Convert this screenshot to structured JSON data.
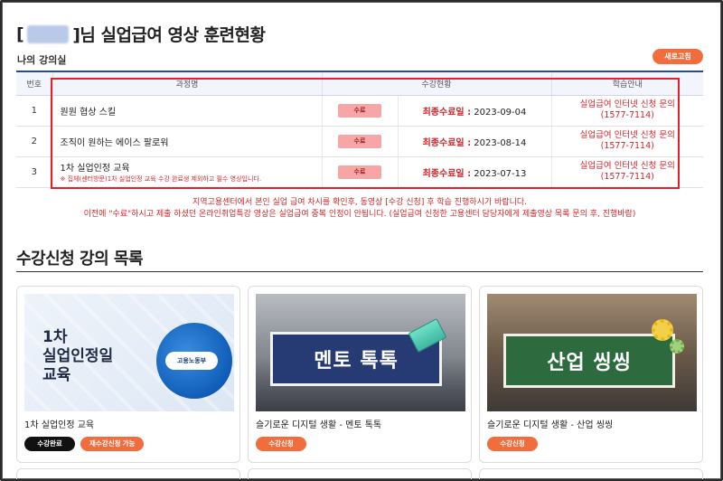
{
  "page": {
    "title_prefix": "[",
    "title_suffix": "]님 실업급여 영상 훈련현황",
    "my_classroom": "나의 강의실",
    "refresh_button": "새로고침"
  },
  "table": {
    "headers": [
      "번호",
      "과정명",
      "수강현황",
      "학습안내"
    ],
    "rows": [
      {
        "no": "1",
        "name": "원원 협상 스킬",
        "note": "",
        "status": "수료",
        "date_label": "최종수료일 :",
        "date": "2023-09-04",
        "inquiry_line1": "실업급여 인터넷 신청 문의",
        "inquiry_line2": "(1577-7114)"
      },
      {
        "no": "2",
        "name": "조직이 원하는 에이스 팔로워",
        "note": "",
        "status": "수료",
        "date_label": "최종수료일 :",
        "date": "2023-08-14",
        "inquiry_line1": "실업급여 인터넷 신청 문의",
        "inquiry_line2": "(1577-7114)"
      },
      {
        "no": "3",
        "name": "1차 실업인정 교육",
        "note": "※ 집체(센터방문)1차 실업인정 교육 수강 완료생 제외하고 필수 영상입니다.",
        "status": "수료",
        "date_label": "최종수료일 :",
        "date": "2023-07-13",
        "inquiry_line1": "실업급여 인터넷 신청 문의",
        "inquiry_line2": "(1577-7114)"
      }
    ]
  },
  "notice": {
    "line1": "지역고용센터에서 본인 실업 급여 차시를 확인후, 동영상 [수강 신청] 후 학습 진행하시기 바랍니다.",
    "line2": "이전에 \"수료\"하시고 제출 하셨던 온라인취업특강 영상은 실업급여 중복 인정이 안됩니다. (실업급여 신청한 고용센터 담당자에게 제출영상 목록 문의 후, 진행바람)"
  },
  "section": {
    "title": "수강신청 강의 목록"
  },
  "cards": [
    {
      "thumb_text": "1차\n실업인정일\n교육",
      "badge": "고용노동부",
      "title": "1차 실업인정 교육",
      "button1": "수강완료",
      "button2": "재수강신청 가능"
    },
    {
      "thumb_text": "멘토 톡톡",
      "title": "슬기로운 디지털 생활 - 멘토 톡톡",
      "button1": "수강신청"
    },
    {
      "thumb_text": "산업 씽씽",
      "title": "슬기로운 디지털 생활 - 산업 씽씽",
      "button1": "수강신청"
    }
  ],
  "colors": {
    "accent_orange": "#f26d3d",
    "alert_red": "#d3252a",
    "header_navy": "#2a4b8a",
    "status_pink": "#f6a6a6"
  }
}
